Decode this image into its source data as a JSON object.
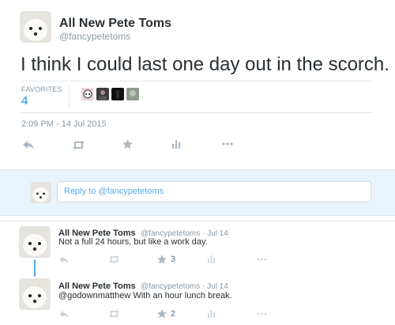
{
  "main_tweet": {
    "author_name": "All New Pete Toms",
    "author_handle": "@fancypetetoms",
    "text": "I think I could last one day out in the scorch.",
    "favorites_label": "FAVORITES",
    "favorites_count": "4",
    "timestamp": "2:09 PM - 14 Jul 2015"
  },
  "reply_box": {
    "placeholder": "Reply to @fancypetetoms"
  },
  "replies": [
    {
      "author_name": "All New Pete Toms",
      "meta": "@fancypetetoms · Jul 14",
      "text": "Not a full 24 hours, but like a work day.",
      "favorite_count": "3"
    },
    {
      "author_name": "All New Pete Toms",
      "meta": "@fancypetetoms · Jul 14",
      "text": "@godownmatthew With an hour lunch break.",
      "favorite_count": "2"
    }
  ],
  "colors": {
    "accent": "#55acee",
    "muted": "#8899a6",
    "icon": "#aab8c2",
    "reply_bg": "#e8f4fb"
  },
  "icons": [
    "reply-icon",
    "retweet-icon",
    "favorite-icon",
    "stats-icon",
    "more-icon"
  ]
}
